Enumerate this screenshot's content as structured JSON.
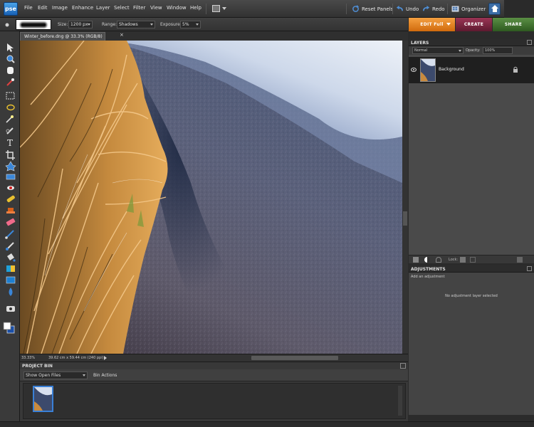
{
  "app": {
    "logo": "pse",
    "menu": [
      "File",
      "Edit",
      "Image",
      "Enhance",
      "Layer",
      "Select",
      "Filter",
      "View",
      "Window",
      "Help"
    ],
    "reset_panels": "Reset Panels",
    "undo": "Undo",
    "redo": "Redo",
    "organizer": "Organizer"
  },
  "options": {
    "size_label": "Size:",
    "size_value": "1200 px",
    "range_label": "Range:",
    "range_value": "Shadows",
    "exposure_label": "Exposure:",
    "exposure_value": "5%"
  },
  "modes": {
    "edit": "EDIT Full",
    "create": "CREATE",
    "share": "SHARE",
    "colors": {
      "edit": "#e8821a",
      "create": "#7a2440",
      "share": "#3f6e2e"
    }
  },
  "document": {
    "tab": "Winter_before.dng @ 33.3% (RGB/8) *",
    "close": "×"
  },
  "status": {
    "zoom": "33.33%",
    "dimensions": "39.62 cm x 59.44 cm (240 ppi)"
  },
  "project_bin": {
    "title": "PROJECT BIN",
    "show": "Show Open Files",
    "actions": "Bin Actions"
  },
  "layers": {
    "title": "LAYERS",
    "blend_mode": "Normal",
    "opacity_label": "Opacity:",
    "opacity_value": "100%",
    "layer_name": "Background",
    "lock_label": "Lock:"
  },
  "adjustments": {
    "title": "ADJUSTMENTS",
    "hint": "Add an adjustment",
    "empty": "No adjustment layer selected"
  },
  "icons": [
    "move-icon",
    "zoom-icon",
    "hand-icon",
    "eyedropper-icon",
    "marquee-icon",
    "lasso-icon",
    "magic-wand-icon",
    "quick-selection-icon",
    "type-icon",
    "crop-icon",
    "cookie-cutter-icon",
    "straighten-icon",
    "red-eye-icon",
    "healing-brush-icon",
    "clone-stamp-icon",
    "eraser-icon",
    "brush-icon",
    "smart-brush-icon",
    "paint-bucket-icon",
    "gradient-icon",
    "shape-icon",
    "blur-icon",
    "sponge-icon",
    "color-swatch-icon"
  ]
}
